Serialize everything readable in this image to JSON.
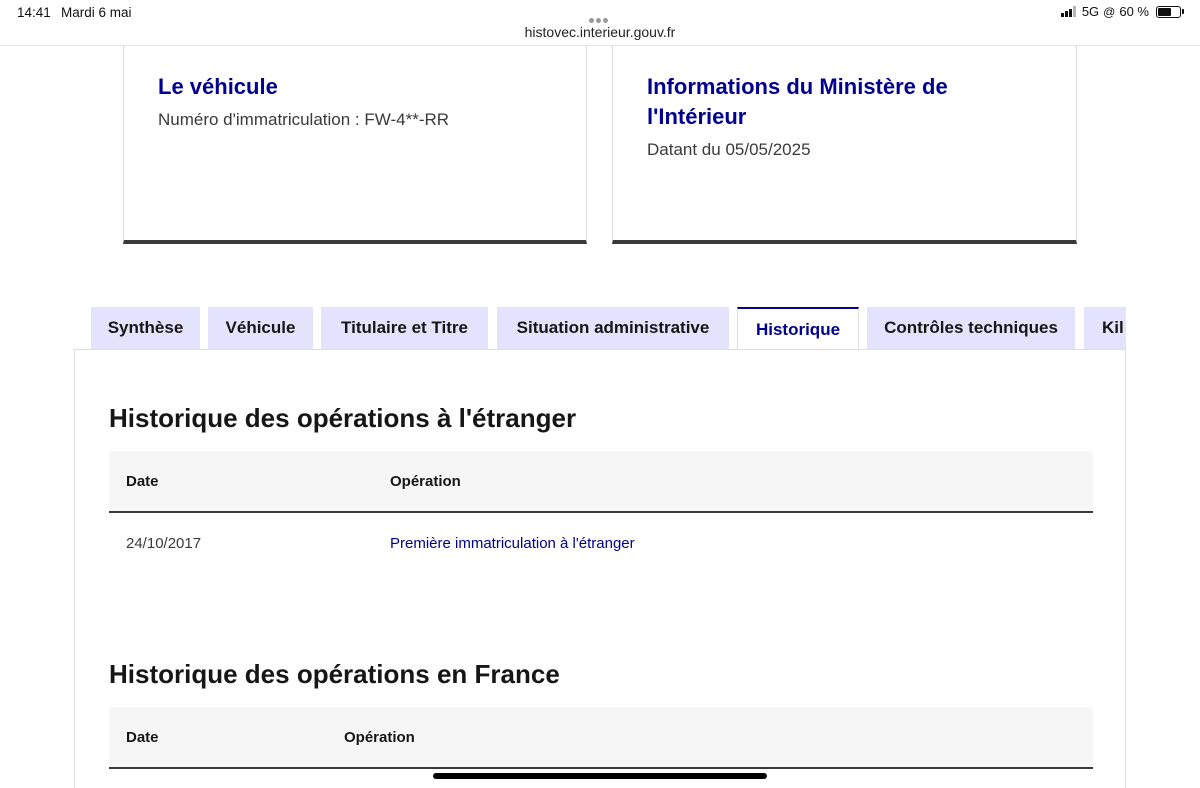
{
  "status_bar": {
    "time": "14:41",
    "date": "Mardi 6 mai",
    "url": "histovec.interieur.gouv.fr",
    "network": "5G",
    "battery_percent": "60 %",
    "battery_level": 0.6
  },
  "vehicle_card": {
    "title": "Le véhicule",
    "registration": "Numéro d'immatriculation : FW-4**-RR"
  },
  "ministry_card": {
    "title": "Informations du Ministère de l'Intérieur",
    "date_text": "Datant du 05/05/2025"
  },
  "tabs": [
    {
      "label": "Synthèse",
      "active": false
    },
    {
      "label": "Véhicule",
      "active": false
    },
    {
      "label": "Titulaire et Titre",
      "active": false
    },
    {
      "label": "Situation administrative",
      "active": false
    },
    {
      "label": "Historique",
      "active": true
    },
    {
      "label": "Contrôles techniques",
      "active": false
    },
    {
      "label": "Kil",
      "active": false
    }
  ],
  "foreign_history": {
    "title": "Historique des opérations à l'étranger",
    "columns": [
      "Date",
      "Opération"
    ],
    "rows": [
      {
        "date": "24/10/2017",
        "operation": "Première immatriculation à l'étranger"
      }
    ]
  },
  "france_history": {
    "title": "Historique des opérations en France",
    "columns": [
      "Date",
      "Opération"
    ]
  },
  "colors": {
    "primary_blue": "#000091",
    "tab_background": "#e3e3fd",
    "header_background": "#f6f6f6",
    "border_dark": "#3a3a3a"
  }
}
